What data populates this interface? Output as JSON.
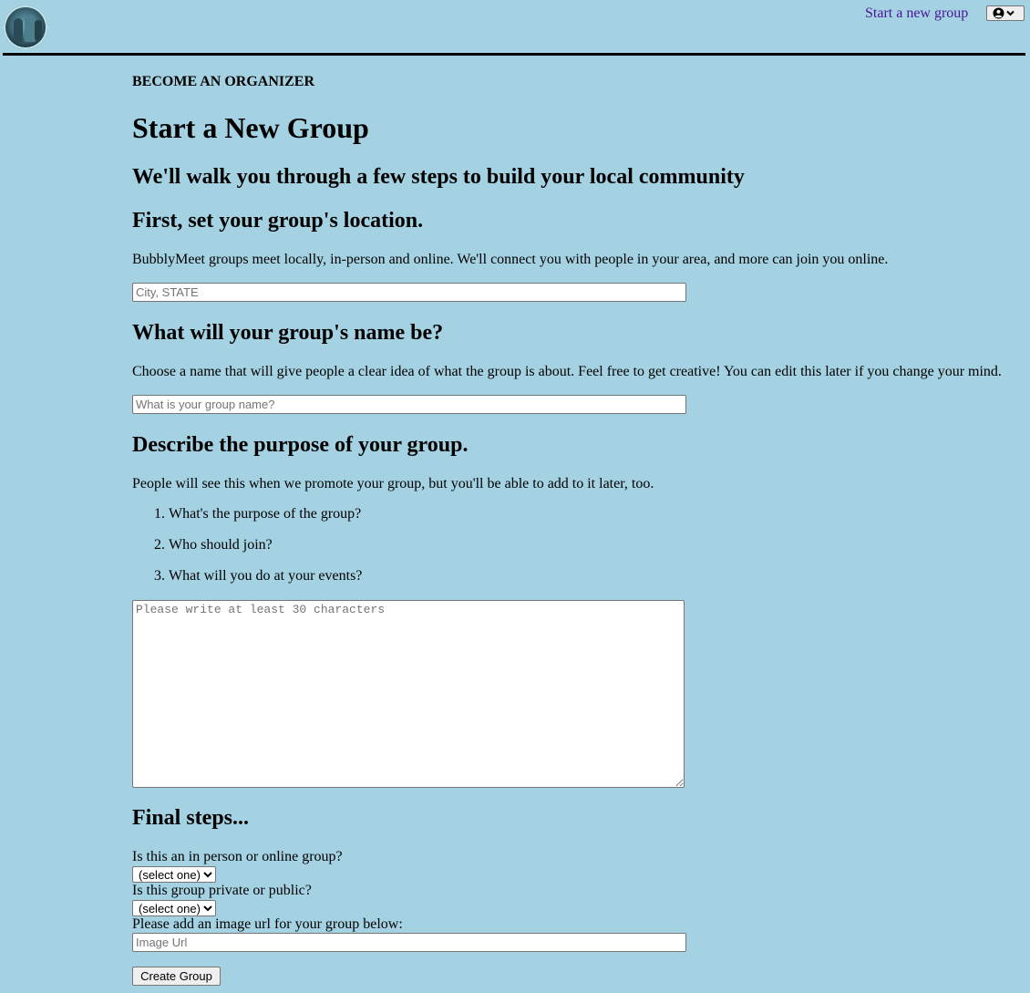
{
  "header": {
    "logo_icon": "group-photo-logo",
    "new_group_link": "Start a new group",
    "user_menu_icon": "user-circle-chevron-icon",
    "link_color": "#4b1599",
    "background": "#a4d2e2"
  },
  "form": {
    "eyebrow": "BECOME AN ORGANIZER",
    "title": "Start a New Group",
    "subtitle": "We'll walk you through a few steps to build your local community",
    "location": {
      "heading": "First, set your group's location.",
      "description": "BubblyMeet groups meet locally, in-person and online. We'll connect you with people in your area, and more can join you online.",
      "placeholder": "City, STATE"
    },
    "name": {
      "heading": "What will your group's name be?",
      "description": "Choose a name that will give people a clear idea of what the group is about. Feel free to get creative! You can edit this later if you change your mind.",
      "placeholder": "What is your group name?"
    },
    "purpose": {
      "heading": "Describe the purpose of your group.",
      "description": "People will see this when we promote your group, but you'll be able to add to it later, too.",
      "questions": [
        "What's the purpose of the group?",
        "Who should join?",
        "What will you do at your events?"
      ],
      "placeholder": "Please write at least 30 characters"
    },
    "final": {
      "heading": "Final steps...",
      "type_label": "Is this an in person or online group?",
      "type_value": "(select one)",
      "privacy_label": "Is this group private or public?",
      "privacy_value": "(select one)",
      "image_label": "Please add an image url for your group below:",
      "image_placeholder": "Image Url"
    },
    "submit_label": "Create Group"
  }
}
